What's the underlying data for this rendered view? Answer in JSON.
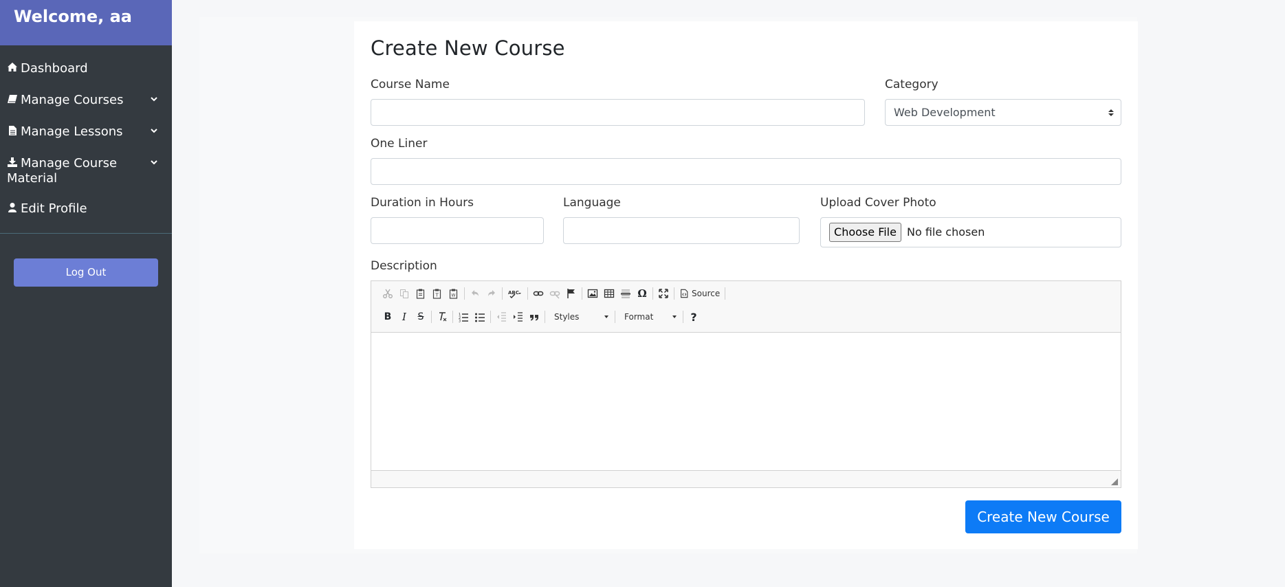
{
  "sidebar": {
    "welcome": "Welcome, aa",
    "items": [
      {
        "label": "Dashboard",
        "icon": "home-icon"
      },
      {
        "label": "Manage Courses",
        "icon": "book-icon",
        "has_dropdown": true
      },
      {
        "label": "Manage Lessons",
        "icon": "file-icon",
        "has_dropdown": true
      },
      {
        "label": "Manage Course Material",
        "icon": "download-icon",
        "has_dropdown": true
      },
      {
        "label": "Edit Profile",
        "icon": "user-icon"
      }
    ],
    "logout_label": "Log Out"
  },
  "form": {
    "title": "Create New Course",
    "course_name": {
      "label": "Course Name",
      "value": ""
    },
    "category": {
      "label": "Category",
      "selected": "Web Development"
    },
    "one_liner": {
      "label": "One Liner",
      "value": ""
    },
    "duration": {
      "label": "Duration in Hours",
      "value": ""
    },
    "language": {
      "label": "Language",
      "value": ""
    },
    "cover_photo": {
      "label": "Upload Cover Photo",
      "button_label": "Choose File",
      "status": "No file chosen"
    },
    "description": {
      "label": "Description",
      "value": ""
    },
    "submit_label": "Create New Course"
  },
  "editor_toolbar": {
    "source_label": "Source",
    "styles_label": "Styles",
    "format_label": "Format",
    "help_label": "?",
    "bold_label": "B",
    "italic_label": "I",
    "strike_label": "S",
    "quote_label": "99",
    "special_char_label": "Ω"
  },
  "colors": {
    "sidebar_bg": "#343a40",
    "sidebar_header_bg": "#5a67b8",
    "logout_bg": "#6c7ed6",
    "primary": "#0d7bf6"
  }
}
